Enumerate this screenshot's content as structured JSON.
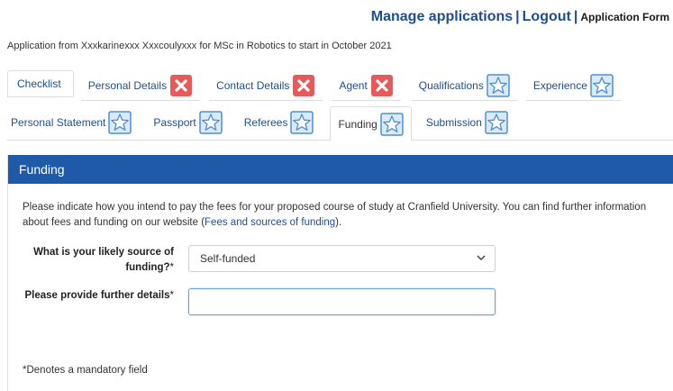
{
  "topnav": {
    "manage": "Manage applications",
    "sep1": "|",
    "logout": "Logout",
    "sep2": "|",
    "current": "Application Form"
  },
  "app_info": "Application from Xxxkarinexxx Xxxcoulyxxx for MSc in Robotics to start in October 2021",
  "tabs_row1": [
    {
      "label": "Checklist",
      "status": "none"
    },
    {
      "label": "Personal Details",
      "status": "incomplete"
    },
    {
      "label": "Contact Details",
      "status": "incomplete"
    },
    {
      "label": "Agent",
      "status": "incomplete"
    },
    {
      "label": "Qualifications",
      "status": "complete"
    },
    {
      "label": "Experience",
      "status": "complete"
    }
  ],
  "tabs_row2": [
    {
      "label": "Personal Statement",
      "status": "complete"
    },
    {
      "label": "Passport",
      "status": "complete"
    },
    {
      "label": "Referees",
      "status": "complete"
    },
    {
      "label": "Funding",
      "status": "complete",
      "active": true
    },
    {
      "label": "Submission",
      "status": "complete"
    }
  ],
  "icons": {
    "incomplete": "red-cross-icon",
    "complete": "blue-star-icon"
  },
  "colors": {
    "brand_blue": "#1e5aa8",
    "link_blue": "#1f4e8c",
    "error_red": "#e85a5a",
    "star_blue": "#4a8fd8"
  },
  "panel": {
    "title": "Funding",
    "intro_text": "Please indicate how you intend to pay the fees for your proposed course of study at Cranfield University. You can find further information about fees and funding on our website (",
    "intro_link": "Fees and sources of funding",
    "intro_end": ").",
    "field1": {
      "label": "What is your likely source of funding?",
      "required_mark": "*",
      "value": "Self-funded"
    },
    "field2": {
      "label": "Please provide further details",
      "required_mark": "*",
      "value": "",
      "placeholder": ""
    },
    "mandatory_note": "*Denotes a mandatory field"
  }
}
